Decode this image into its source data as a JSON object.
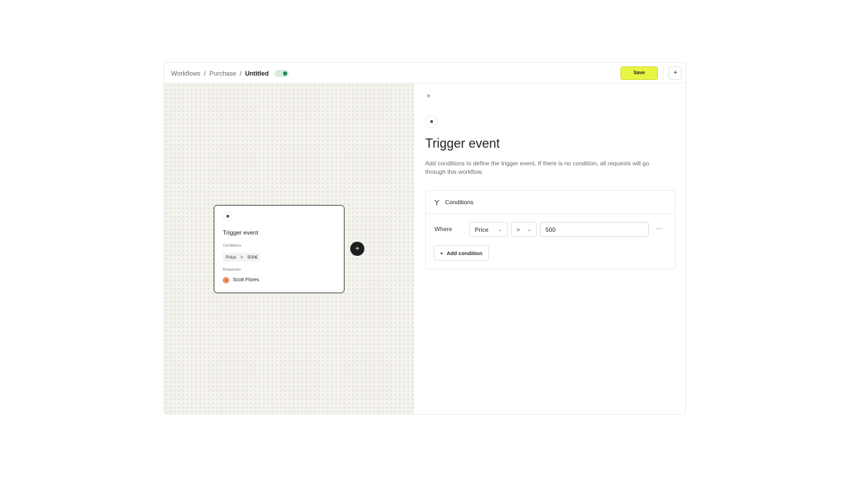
{
  "breadcrumb": {
    "items": [
      "Workflows",
      "Purchase"
    ],
    "current": "Untitled",
    "separator": "/"
  },
  "toolbar": {
    "save_label": "Save",
    "add_icon": "+"
  },
  "card": {
    "title": "Trigger event",
    "conditions_label": "Conditions",
    "condition": {
      "field": "Price",
      "operator": ">",
      "value": "500€"
    },
    "requester_label": "Requester",
    "requester_name": "Scott Flores"
  },
  "canvas": {
    "add_icon": "+"
  },
  "panel": {
    "collapse_icon": "»",
    "title": "Trigger event",
    "description": "Add conditions to define the trigger event. If there is no condition, all requests will go through this workflow.",
    "conditions": {
      "header": "Conditions",
      "where_label": "Where",
      "field_select": "Price",
      "operator_select": ">",
      "value": "500",
      "more_icon": "···",
      "add_label": "Add condition",
      "add_icon": "+"
    }
  },
  "colors": {
    "accent": "#e8f542",
    "toggle_on": "#1e8a55",
    "canvas_bg": "#f4f2ed"
  },
  "icons": [
    "collapse-icon",
    "branch-icon",
    "chevron-down-icon",
    "more-icon",
    "plus-icon"
  ]
}
